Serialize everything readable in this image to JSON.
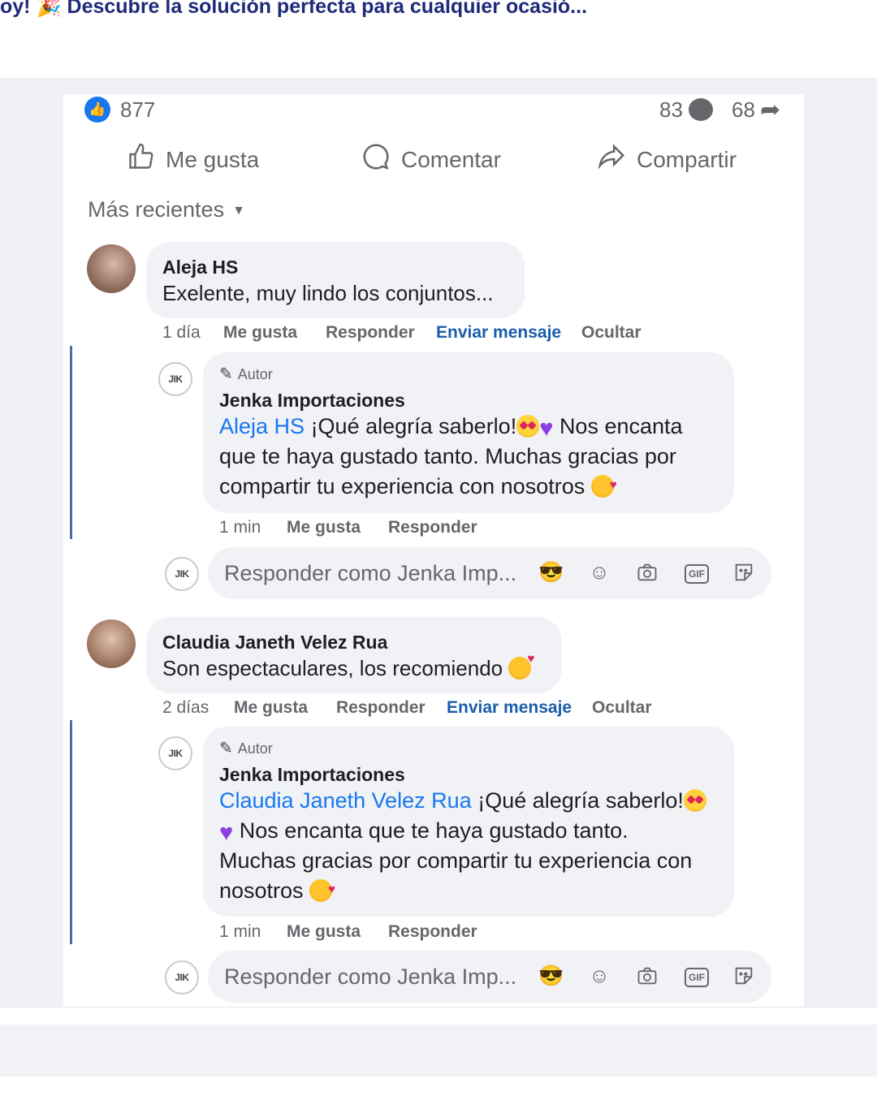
{
  "banner": {
    "text": "oy! 🎉 Descubre la solución perfecta para cualquier ocasió..."
  },
  "post_stats": {
    "likes": "877",
    "comments": "83",
    "shares": "68"
  },
  "actions": {
    "like": "Me gusta",
    "comment": "Comentar",
    "share": "Compartir"
  },
  "sort": {
    "label": "Más recientes"
  },
  "comments": [
    {
      "author": "Aleja HS",
      "text": "Exelente, muy lindo los conjuntos...",
      "time": "1 día",
      "like": "Me gusta",
      "reply": "Responder",
      "message": "Enviar mensaje",
      "hide": "Ocultar",
      "author_reply": {
        "tag": "Autor",
        "page_name": "Jenka Importaciones",
        "mention": "Aleja HS",
        "text_1": "¡Qué alegría saberlo!",
        "text_2": "Nos encanta",
        "text_3": "que te haya gustado tanto. Muchas gracias por",
        "text_4": "compartir tu experiencia con nosotros",
        "time": "1 min",
        "like": "Me gusta",
        "reply": "Responder"
      },
      "reply_box": {
        "placeholder": "Responder como Jenka Imp..."
      }
    },
    {
      "author": "Claudia Janeth Velez Rua",
      "text": "Son espectaculares, los recomiendo",
      "time": "2 días",
      "like": "Me gusta",
      "reply": "Responder",
      "message": "Enviar mensaje",
      "hide": "Ocultar",
      "author_reply": {
        "tag": "Autor",
        "page_name": "Jenka Importaciones",
        "mention": "Claudia Janeth Velez Rua",
        "text_1": "¡Qué alegría saberlo!",
        "text_2": "Nos encanta que te haya gustado tanto.",
        "text_3": "Muchas gracias por compartir tu experiencia con",
        "text_4": "nosotros",
        "time": "1 min",
        "like": "Me gusta",
        "reply": "Responder"
      },
      "reply_box": {
        "placeholder": "Responder como Jenka Imp..."
      }
    }
  ],
  "logo_initials": "JIK",
  "icons": {
    "like_badge": "thumbs-up-icon",
    "comment_count": "comment-bubble-icon",
    "share_count": "share-arrow-icon",
    "tools": [
      "avatar-sticker-icon",
      "emoji-icon",
      "camera-icon",
      "gif-icon",
      "sticker-icon"
    ]
  },
  "colors": {
    "accent": "#1877f2",
    "thread_line": "#4b6ea9",
    "bubble": "#f0f2f5",
    "link": "#1a5dab"
  }
}
